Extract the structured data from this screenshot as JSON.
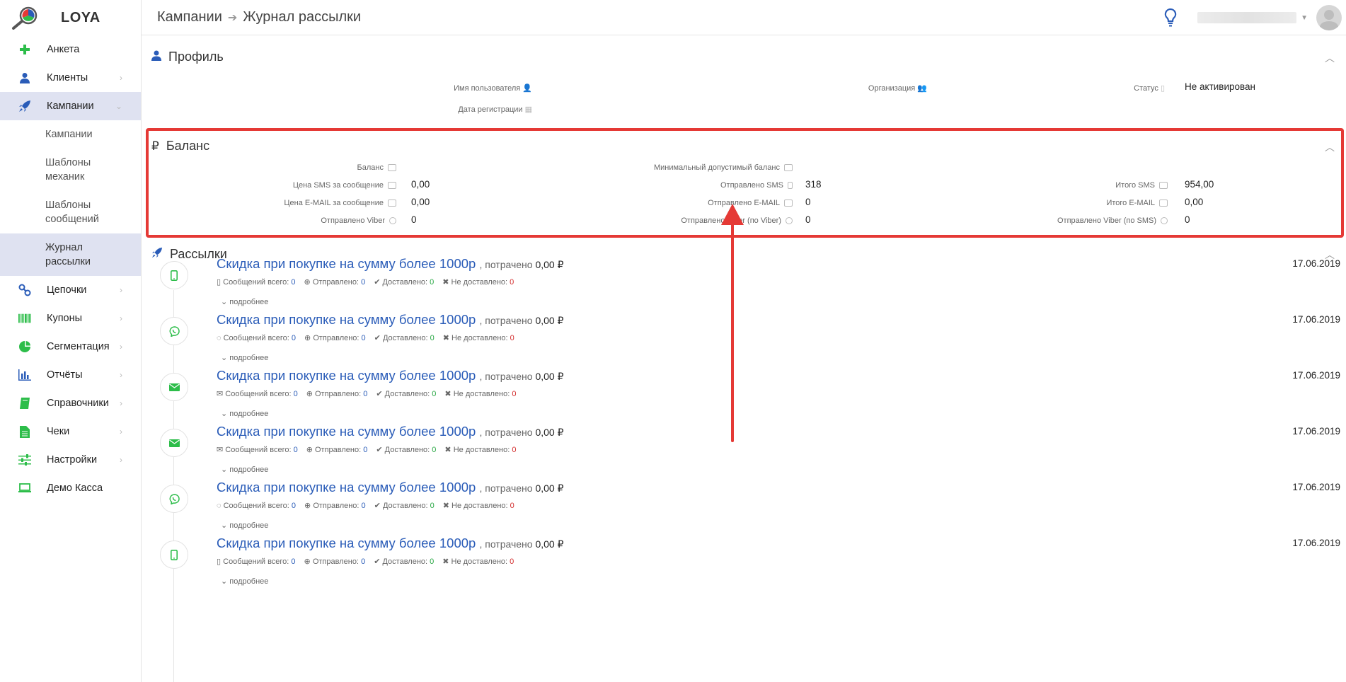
{
  "app": {
    "name": "LOYA"
  },
  "sidebar": {
    "items": [
      {
        "label": "Анкета",
        "icon": "plus-icon",
        "color": "#2dbd4a",
        "chevron": false
      },
      {
        "label": "Клиенты",
        "icon": "user-icon",
        "color": "#2a5cb8",
        "chevron": true
      },
      {
        "label": "Кампании",
        "icon": "rocket-icon",
        "color": "#2a5cb8",
        "chevron": true,
        "active": true
      }
    ],
    "sub_items": [
      {
        "label": "Кампании"
      },
      {
        "label": "Шаблоны механик"
      },
      {
        "label": "Шаблоны сообщений"
      },
      {
        "label": "Журнал рассылки",
        "active": true
      }
    ],
    "items_after": [
      {
        "label": "Цепочки",
        "icon": "link-icon",
        "color": "#2a5cb8"
      },
      {
        "label": "Купоны",
        "icon": "barcode-icon",
        "color": "#2dbd4a"
      },
      {
        "label": "Сегментация",
        "icon": "pie-icon",
        "color": "#2dbd4a"
      },
      {
        "label": "Отчёты",
        "icon": "bar-chart-icon",
        "color": "#2a5cb8"
      },
      {
        "label": "Справочники",
        "icon": "book-icon",
        "color": "#2dbd4a"
      },
      {
        "label": "Чеки",
        "icon": "file-icon",
        "color": "#2dbd4a"
      },
      {
        "label": "Настройки",
        "icon": "sliders-icon",
        "color": "#2dbd4a"
      },
      {
        "label": "Демо Касса",
        "icon": "laptop-icon",
        "color": "#2dbd4a"
      }
    ]
  },
  "header": {
    "breadcrumb_1": "Кампании",
    "breadcrumb_2": "Журнал рассылки"
  },
  "profile": {
    "title": "Профиль",
    "username_label": "Имя пользователя",
    "reg_date_label": "Дата регистрации",
    "org_label": "Организация",
    "status_label": "Статус",
    "status_value": "Не активирован"
  },
  "balance": {
    "title": "Баланс",
    "balance_label": "Баланс",
    "min_balance_label": "Минимальный допустимый баланс",
    "sms_price_label": "Цена SMS за сообщение",
    "sms_price_value": "0,00",
    "email_price_label": "Цена E-MAIL за сообщение",
    "email_price_value": "0,00",
    "viber_sent_label": "Отправлено Viber",
    "viber_sent_value": "0",
    "sms_sent_label": "Отправлено SMS",
    "sms_sent_value": "318",
    "email_sent_label": "Отправлено E-MAIL",
    "email_sent_value": "0",
    "viber_no_viber_label": "Отправлено Viber (по Viber)",
    "viber_no_viber_value": "0",
    "total_sms_label": "Итого SMS",
    "total_sms_value": "954,00",
    "total_email_label": "Итого E-MAIL",
    "total_email_value": "0,00",
    "viber_no_sms_label": "Отправлено Viber (по SMS)",
    "viber_no_sms_value": "0"
  },
  "mailings": {
    "title": "Рассылки",
    "more_label": "подробнее",
    "stat_total": "Сообщений всего:",
    "stat_sent": "Отправлено:",
    "stat_delivered": "Доставлено:",
    "stat_not_delivered": "Не доставлено:",
    "spent_label": ", потрачено",
    "items": [
      {
        "channel": "phone-icon",
        "title": "Скидка при покупке на сумму более 1000р",
        "spent": "0,00 ₽",
        "date": "17.06.2019",
        "total": "0",
        "sent": "0",
        "delivered": "0",
        "not_delivered": "0"
      },
      {
        "channel": "viber-icon",
        "title": "Скидка при покупке на сумму более 1000р",
        "spent": "0,00 ₽",
        "date": "17.06.2019",
        "total": "0",
        "sent": "0",
        "delivered": "0",
        "not_delivered": "0"
      },
      {
        "channel": "envelope-icon",
        "title": "Скидка при покупке на сумму более 1000р",
        "spent": "0,00 ₽",
        "date": "17.06.2019",
        "total": "0",
        "sent": "0",
        "delivered": "0",
        "not_delivered": "0"
      },
      {
        "channel": "envelope-icon",
        "title": "Скидка при покупке на сумму более 1000р",
        "spent": "0,00 ₽",
        "date": "17.06.2019",
        "total": "0",
        "sent": "0",
        "delivered": "0",
        "not_delivered": "0"
      },
      {
        "channel": "viber-icon",
        "title": "Скидка при покупке на сумму более 1000р",
        "spent": "0,00 ₽",
        "date": "17.06.2019",
        "total": "0",
        "sent": "0",
        "delivered": "0",
        "not_delivered": "0"
      },
      {
        "channel": "phone-icon",
        "title": "Скидка при покупке на сумму более 1000р",
        "spent": "0,00 ₽",
        "date": "17.06.2019",
        "total": "0",
        "sent": "0",
        "delivered": "0",
        "not_delivered": "0"
      }
    ]
  },
  "colors": {
    "accent": "#2a5cb8",
    "green": "#2dbd4a",
    "highlight": "#e53935",
    "active_bg": "#dfe2f1"
  }
}
